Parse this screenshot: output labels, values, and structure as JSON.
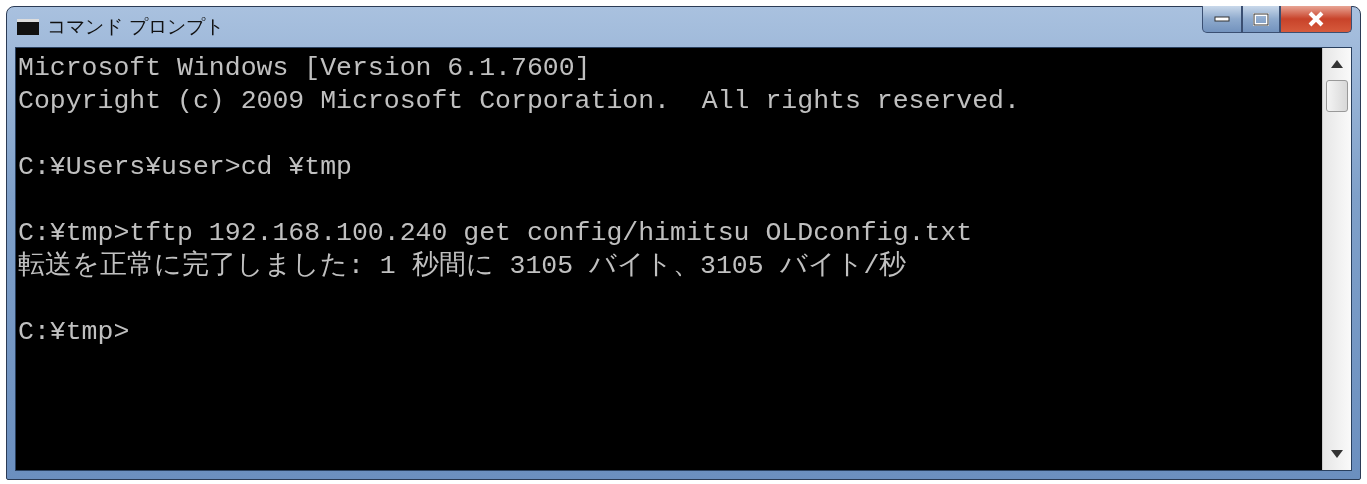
{
  "window": {
    "title": "コマンド プロンプト"
  },
  "console": {
    "blocks": [
      [
        "Microsoft Windows [Version 6.1.7600]",
        "Copyright (c) 2009 Microsoft Corporation.  All rights reserved."
      ],
      [
        "C:¥Users¥user>cd ¥tmp"
      ],
      [
        "C:¥tmp>tftp 192.168.100.240 get config/himitsu OLDconfig.txt",
        "転送を正常に完了しました: 1 秒間に 3105 バイト、3105 バイト/秒"
      ],
      [
        "C:¥tmp>"
      ]
    ]
  }
}
